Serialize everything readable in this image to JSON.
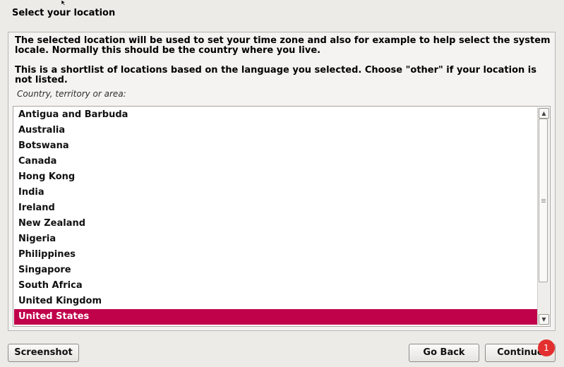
{
  "header": {
    "title": "Select your location"
  },
  "content": {
    "description": "The selected location will be used to set your time zone and also for example to help select the system locale. Normally this should be the country where you live.",
    "shortlist_note": "This is a shortlist of locations based on the language you selected. Choose \"other\" if your location is not listed.",
    "field_label": "Country, territory or area:"
  },
  "locations": {
    "items": [
      {
        "label": "Antigua and Barbuda"
      },
      {
        "label": "Australia"
      },
      {
        "label": "Botswana"
      },
      {
        "label": "Canada"
      },
      {
        "label": "Hong Kong"
      },
      {
        "label": "India"
      },
      {
        "label": "Ireland"
      },
      {
        "label": "New Zealand"
      },
      {
        "label": "Nigeria"
      },
      {
        "label": "Philippines"
      },
      {
        "label": "Singapore"
      },
      {
        "label": "South Africa"
      },
      {
        "label": "United Kingdom"
      },
      {
        "label": "United States"
      }
    ],
    "selected_index": 13
  },
  "buttons": {
    "screenshot": "Screenshot",
    "back": "Go Back",
    "continue": "Continue"
  },
  "notification_badge": "1",
  "colors": {
    "selection": "#c0024b",
    "background": "#ecebe8",
    "badge": "#e32f2f"
  },
  "icons": {
    "scroll_up": "scroll-up-arrow-icon",
    "scroll_down": "scroll-down-arrow-icon",
    "cursor": "mouse-pointer-icon"
  }
}
